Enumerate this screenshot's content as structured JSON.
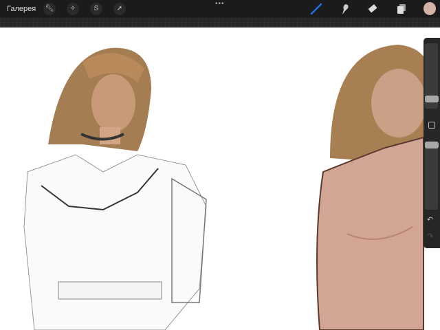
{
  "topbar": {
    "gallery_label": "Галерея",
    "more": "•••",
    "left_tools": [
      "wrench-icon",
      "magic-wand-icon",
      "selection-icon",
      "transform-arrow-icon"
    ],
    "right_tools": [
      "brush-icon",
      "smudge-icon",
      "eraser-icon",
      "layers-icon"
    ],
    "accent": "#1a73e8",
    "current_color": "#d3b3a6"
  },
  "sidebar": {
    "brush_size": 0.3,
    "opacity": 0.05,
    "undo": "↶",
    "redo": "↷"
  }
}
